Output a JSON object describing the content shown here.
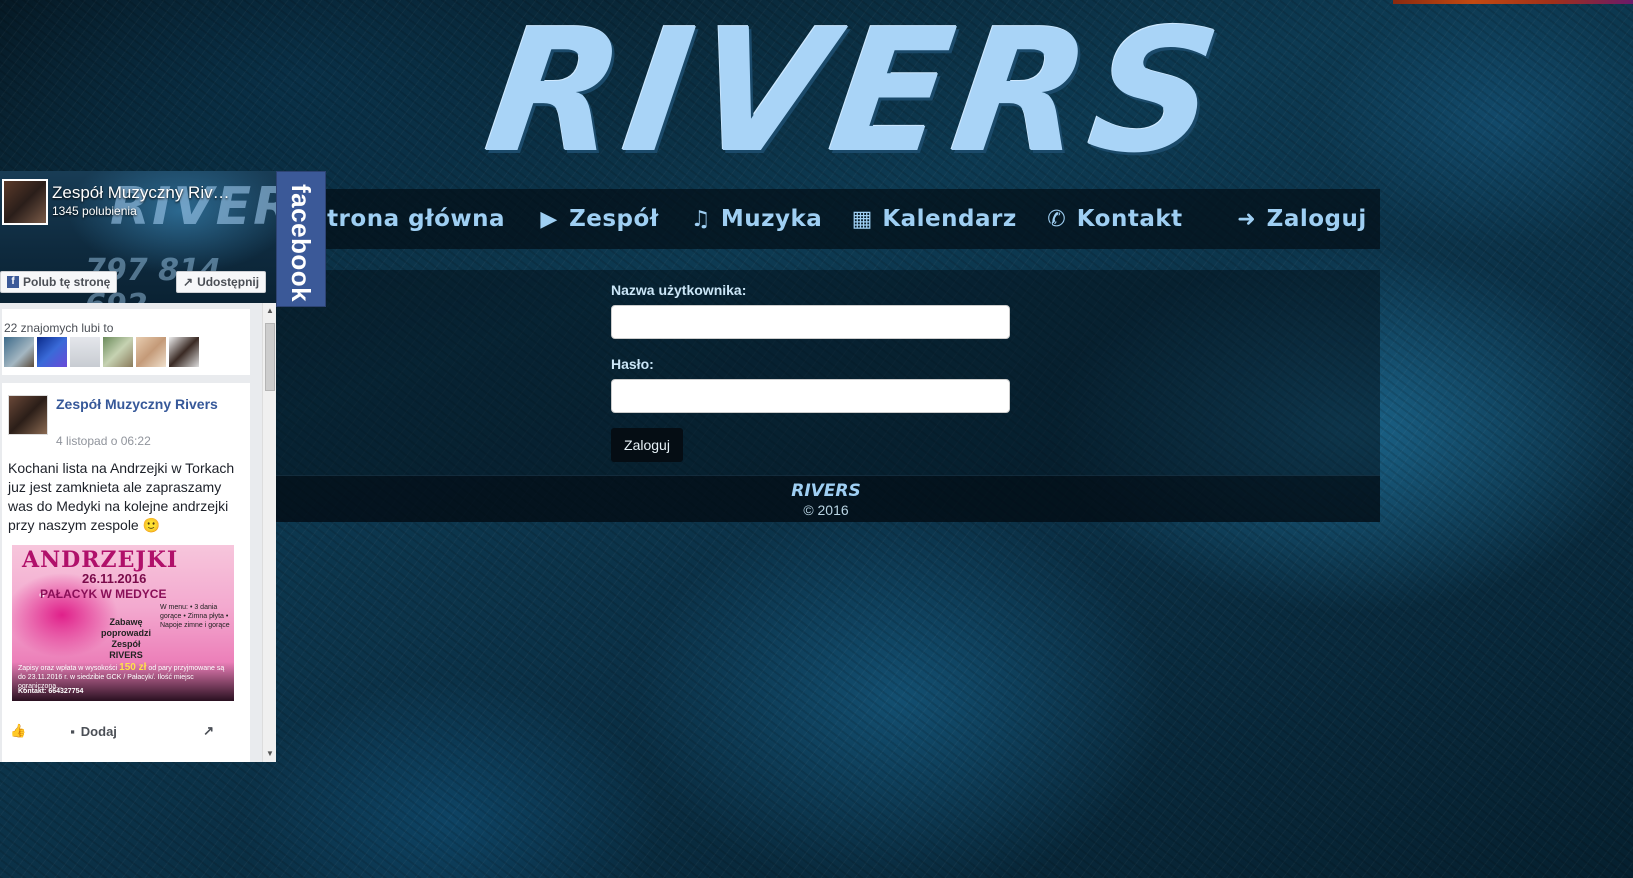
{
  "brand": {
    "logo_text": "RIVERS"
  },
  "nav": {
    "items": [
      {
        "label": "Strona główna",
        "icon": "home-icon",
        "glyph": ""
      },
      {
        "label": "Zespół",
        "icon": "play-icon",
        "glyph": "▶"
      },
      {
        "label": "Muzyka",
        "icon": "music-icon",
        "glyph": "♫"
      },
      {
        "label": "Kalendarz",
        "icon": "calendar-icon",
        "glyph": "▦"
      },
      {
        "label": "Kontakt",
        "icon": "phone-icon",
        "glyph": "✆"
      }
    ],
    "login": {
      "label": "Zaloguj",
      "icon": "sign-in-icon",
      "glyph": "➜"
    }
  },
  "login_form": {
    "username_label": "Nazwa użytkownika:",
    "username_value": "",
    "password_label": "Hasło:",
    "password_value": "",
    "submit_label": "Zaloguj"
  },
  "footer": {
    "brand": "RIVERS",
    "copyright": "© 2016"
  },
  "facebook": {
    "tab_label": "facebook",
    "cover_brand": "RIVERS",
    "cover_phone": "797 814 692",
    "page_name": "Zespół Muzyczny Riv…",
    "likes": "1345 polubienia",
    "like_button": "Polub tę stronę",
    "share_button": "Udostępnij",
    "friends_like": "22 znajomych lubi to",
    "post": {
      "author": "Zespół Muzyczny Rivers",
      "date": "4 listopad o 06:22",
      "text": "Kochani lista na Andrzejki w Torkach juz jest zamknieta ale zapraszamy was do Medyki na kolejne andrzejki przy naszym zespole 🙂",
      "poster": {
        "title": "ANDRZEJKI",
        "date": "26.11.2016",
        "venue": "PAŁACYK W MEDYCE",
        "band": "Zabawę poprowadzi Zespół RIVERS",
        "menu": "W menu: • 3 dania gorące • Zimna płyta • Napoje zimne i gorące",
        "price_prefix": "Zapisy oraz wpłata w wysokości",
        "price": "150 zł",
        "price_suffix": "od pary przyjmowane są do 23.11.2016 r. w siedzibie GCK / Pałacyk/. Ilość miejsc ograniczona...",
        "contact": "Kontakt: 664327754"
      },
      "comment_label": "Dodaj"
    }
  },
  "colors": {
    "accent": "#9fcff3",
    "facebook_blue": "#3b5998",
    "link_blue": "#365899"
  }
}
